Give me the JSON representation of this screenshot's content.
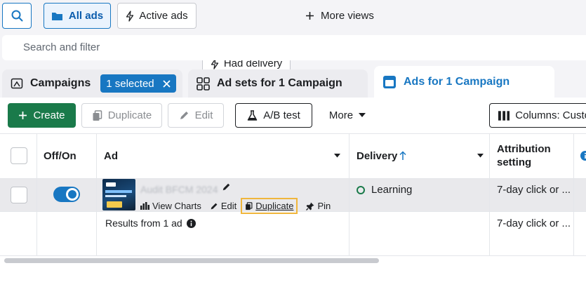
{
  "views": {
    "all_ads": "All ads",
    "active_ads": "Active ads",
    "had_delivery": "Had delivery",
    "more_views": "More views"
  },
  "search": {
    "placeholder": "Search and filter"
  },
  "tabs": {
    "campaigns": "Campaigns",
    "selected_badge": "1 selected",
    "ad_sets": "Ad sets for 1 Campaign",
    "ads": "Ads for 1 Campaign"
  },
  "toolbar": {
    "create": "Create",
    "duplicate": "Duplicate",
    "edit": "Edit",
    "ab_test": "A/B test",
    "more": "More",
    "columns": "Columns: Custo"
  },
  "table": {
    "headers": {
      "off_on": "Off/On",
      "ad": "Ad",
      "delivery": "Delivery",
      "attribution_line1": "Attribution",
      "attribution_line2": "setting"
    },
    "rows": [
      {
        "ad_name": "Audit BFCM 2024",
        "toggle_on": true,
        "actions": {
          "view_charts": "View Charts",
          "edit": "Edit",
          "duplicate": "Duplicate",
          "pin": "Pin"
        },
        "delivery": "Learning",
        "attribution": "7-day click or ..."
      }
    ],
    "summary": {
      "label": "Results from 1 ad",
      "attribution": "7-day click or ..."
    }
  },
  "colors": {
    "accent": "#1877c2",
    "create_green": "#1a7a4a",
    "highlight": "#f0b63c"
  }
}
